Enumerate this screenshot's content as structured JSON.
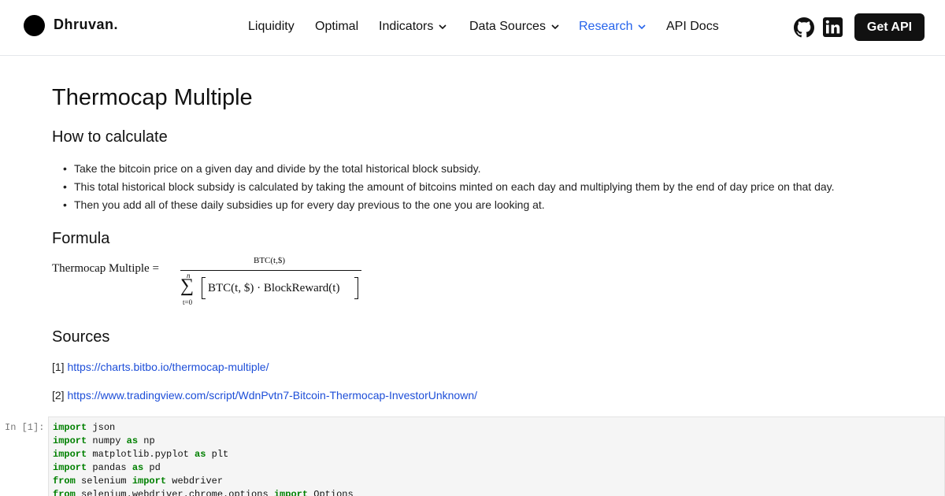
{
  "header": {
    "brand": "Dhruvan.",
    "nav": [
      {
        "label": "Liquidity"
      },
      {
        "label": "Optimal"
      },
      {
        "label": "Indicators"
      },
      {
        "label": "Data Sources"
      },
      {
        "label": "Research"
      },
      {
        "label": "API Docs"
      }
    ],
    "active_nav": "Research",
    "social_icons": [
      "github-icon",
      "linkedin-icon"
    ],
    "cta_label": "Get API",
    "accent_color": "#2563eb"
  },
  "page": {
    "title": "Thermocap Multiple",
    "how_heading": "How to calculate",
    "bullets": [
      "Take the bitcoin price on a given day and divide by the total historical block subsidy.",
      "This total historical block subsidy is calculated by taking the amount of bitcoins minted on each day and multiplying them by the end of day price on that day.",
      "Then you add all of these daily subsidies up for every day previous to the one you are looking at."
    ],
    "formula_heading": "Formula",
    "formula": {
      "lhs": "Thermocap Multiple =",
      "numerator": "BTC(t,$)",
      "sum_upper": "n",
      "sum_lower": "t=0",
      "denominator": "BTC(t, $) · BlockReward(t)"
    },
    "sources_heading": "Sources",
    "sources": [
      {
        "index": "[1]",
        "url": "https://charts.bitbo.io/thermocap-multiple/"
      },
      {
        "index": "[2]",
        "url": "https://www.tradingview.com/script/WdnPvtn7-Bitcoin-Thermocap-InvestorUnknown/"
      }
    ]
  },
  "code_cell": {
    "prompt": "In [1]:",
    "lines": [
      [
        {
          "k": "import"
        },
        {
          "t": " json"
        }
      ],
      [
        {
          "k": "import"
        },
        {
          "t": " numpy "
        },
        {
          "k": "as"
        },
        {
          "t": " np"
        }
      ],
      [
        {
          "k": "import"
        },
        {
          "t": " matplotlib.pyplot "
        },
        {
          "k": "as"
        },
        {
          "t": " plt"
        }
      ],
      [
        {
          "k": "import"
        },
        {
          "t": " pandas "
        },
        {
          "k": "as"
        },
        {
          "t": " pd"
        }
      ],
      [
        {
          "k": "from"
        },
        {
          "t": " selenium "
        },
        {
          "k": "import"
        },
        {
          "t": " webdriver"
        }
      ],
      [
        {
          "k": "from"
        },
        {
          "t": " selenium.webdriver.chrome.options "
        },
        {
          "k": "import"
        },
        {
          "t": " Options"
        }
      ]
    ]
  }
}
